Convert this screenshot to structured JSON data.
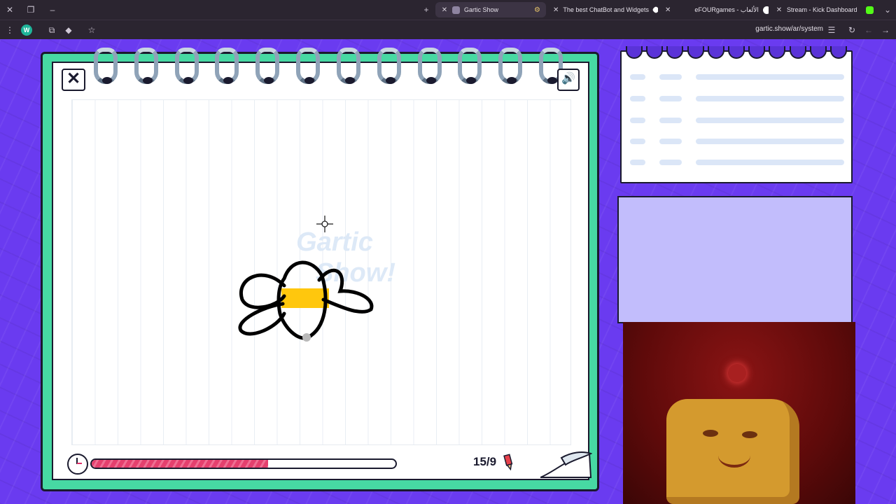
{
  "browser": {
    "tabs": [
      {
        "title": "Gartic Show",
        "active": true,
        "favicon_color": "#c9c2cf"
      },
      {
        "title": "The best ChatBot and Widgets",
        "active": false,
        "favicon_color": "#ffffff"
      },
      {
        "title": "eFOURgames - الألعاب",
        "active": false,
        "favicon_color": "#ffffff"
      },
      {
        "title": "Stream - Kick Dashboard",
        "active": false,
        "favicon_color": "#53fc18"
      }
    ],
    "new_tab": "+",
    "address": "gartic.show/ar/system",
    "profile_initial": "W"
  },
  "game": {
    "watermark_line1": "Gartic",
    "watermark_line2": "Show!",
    "timer_progress": 0.58,
    "round_text": "15/9",
    "close_label": "✕",
    "sound_icon": "🔊"
  },
  "colors": {
    "page_bg": "#6a3bf0",
    "notebook_border": "#47d9a3",
    "progress_fill": "#e5406e",
    "chat_panel": "#c2bdfc",
    "drawing_fill": "#ffc400"
  },
  "scoreboard": {
    "rows": 5
  }
}
